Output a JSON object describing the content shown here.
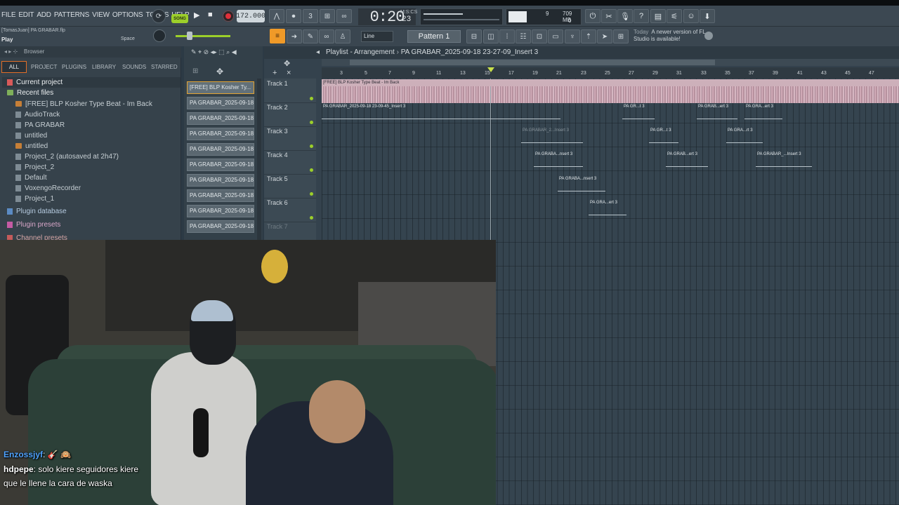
{
  "menu": [
    "FILE",
    "EDIT",
    "ADD",
    "PATTERNS",
    "VIEW",
    "OPTIONS",
    "TOOLS",
    "HELP"
  ],
  "transport": {
    "song_label": "SONG",
    "tempo": "172.000",
    "time": "0:20",
    "time_fraction": "23",
    "time_unit": "M:S:CS",
    "cpu_value": "9",
    "memory": "709 MB",
    "voices": "0"
  },
  "hint_panel": {
    "user_file": "[TomasJuan] PA GRABAR.flp",
    "action": "Play",
    "shortcut": "Space"
  },
  "toolbar2": {
    "snap": "Line",
    "pattern": "Pattern 1",
    "news_today": "Today",
    "news_text": "A newer version of FL Studio is available!"
  },
  "browser": {
    "title": "Browser",
    "tabs": [
      "ALL",
      "PROJECT",
      "PLUGINS",
      "LIBRARY",
      "SOUNDS",
      "STARRED"
    ],
    "items": [
      {
        "label": "Current project",
        "kind": "cat"
      },
      {
        "label": "Recent files",
        "kind": "cat-open"
      },
      {
        "label": "[FREE] BLP Kosher Type Beat - Im Back",
        "kind": "folder"
      },
      {
        "label": "AudioTrack",
        "kind": "file"
      },
      {
        "label": "PA GRABAR",
        "kind": "file"
      },
      {
        "label": "untitled",
        "kind": "file"
      },
      {
        "label": "untitled",
        "kind": "folder"
      },
      {
        "label": "Project_2 (autosaved at 2h47)",
        "kind": "file"
      },
      {
        "label": "Project_2",
        "kind": "file"
      },
      {
        "label": "Default",
        "kind": "file"
      },
      {
        "label": "VoxengoRecorder",
        "kind": "file"
      },
      {
        "label": "Project_1",
        "kind": "file"
      },
      {
        "label": "Plugin database",
        "kind": "cat"
      },
      {
        "label": "Plugin presets",
        "kind": "cat"
      },
      {
        "label": "Channel presets",
        "kind": "cat"
      }
    ]
  },
  "channels": [
    "[FREE] BLP Kosher Ty...",
    "PA GRABAR_2025-09-18...",
    "PA GRABAR_2025-09-18...",
    "PA GRABAR_2025-09-18...",
    "PA GRABAR_2025-09-18...",
    "PA GRABAR_2025-09-18...",
    "PA GRABAR_2025-09-18...",
    "PA GRABAR_2025-09-18...",
    "PA GRABAR_2025-09-18...",
    "PA GRABAR_2025-09-18..."
  ],
  "playlist": {
    "title": "Playlist - Arrangement",
    "pattern": "PA GRABAR_2025-09-18 23-27-09_Insert 3",
    "ruler": [
      "3",
      "5",
      "7",
      "9",
      "11",
      "13",
      "15",
      "17",
      "19",
      "21",
      "23",
      "25",
      "27",
      "29",
      "31",
      "33",
      "35",
      "37",
      "39",
      "41",
      "43",
      "45",
      "47"
    ],
    "tracks": [
      "Track 1",
      "Track 2",
      "Track 3",
      "Track 4",
      "Track 5",
      "Track 6",
      "Track 7"
    ],
    "clips": {
      "t1": "[FREE] BLP Kosher Type Beat - Im Back",
      "t2a": "PA GRABAR_2025-09-18 23-09-45_Insert 3",
      "t2b": "PA GR...t 3",
      "t2c": "PA GRAB...ert 3",
      "t2d": "PA GRA...ert 3",
      "t3a": "PA GRABAR_2...Insert 3",
      "t3b": "PA GR...t 3",
      "t3c": "PA GRA...rt 3",
      "t4a": "PA GRABA...nsert 3",
      "t4b": "PA GRAB...ert 3",
      "t4c": "PA GRABAR_...Insert 3",
      "t5a": "PA GRABA...nsert 3",
      "t6a": "PA GRA...ert 3"
    }
  },
  "chat": [
    {
      "user": "Enzossjyf",
      "text": ": 🎸 🙉"
    },
    {
      "user": "hdpepe",
      "text": ": solo kiere seguidores kiere que le llene la cara de waska"
    }
  ],
  "colors": {
    "accent": "#9ccf2a",
    "orange": "#f09a28",
    "clip_pink": "#cdb0ba",
    "background": "#34424d"
  }
}
